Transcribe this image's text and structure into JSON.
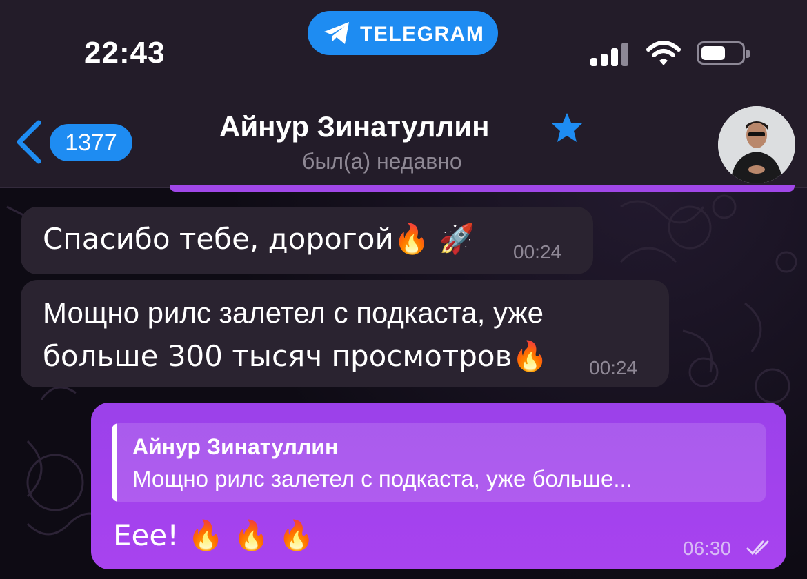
{
  "status_bar": {
    "time": "22:43",
    "app_pill": "TELEGRAM"
  },
  "header": {
    "back_count": "1377",
    "contact_name": "Айнур Зинатуллин",
    "contact_status": "был(а) недавно"
  },
  "messages": [
    {
      "text": "Спасибо тебе, дорогой🔥 🚀",
      "time": "00:24",
      "direction": "incoming"
    },
    {
      "line1": "Мощно рилс залетел с подкаста, уже",
      "line2": "больше 300 тысяч просмотров🔥",
      "time": "00:24",
      "direction": "incoming"
    },
    {
      "reply_name": "Айнур Зинатуллин",
      "reply_text": "Мощно рилс залетел с подкаста, уже больше...",
      "text": "Еее! 🔥 🔥 🔥",
      "time": "06:30",
      "direction": "outgoing"
    }
  ],
  "colors": {
    "accent": "#1e8cf2",
    "outgoing_bubble": "#a043ec",
    "incoming_bubble": "#2a2330",
    "header_bg": "#231c29"
  },
  "icons": [
    "telegram-plane-icon",
    "signal-icon",
    "wifi-icon",
    "battery-icon",
    "back-chevron-icon",
    "star-icon",
    "double-check-icon"
  ]
}
